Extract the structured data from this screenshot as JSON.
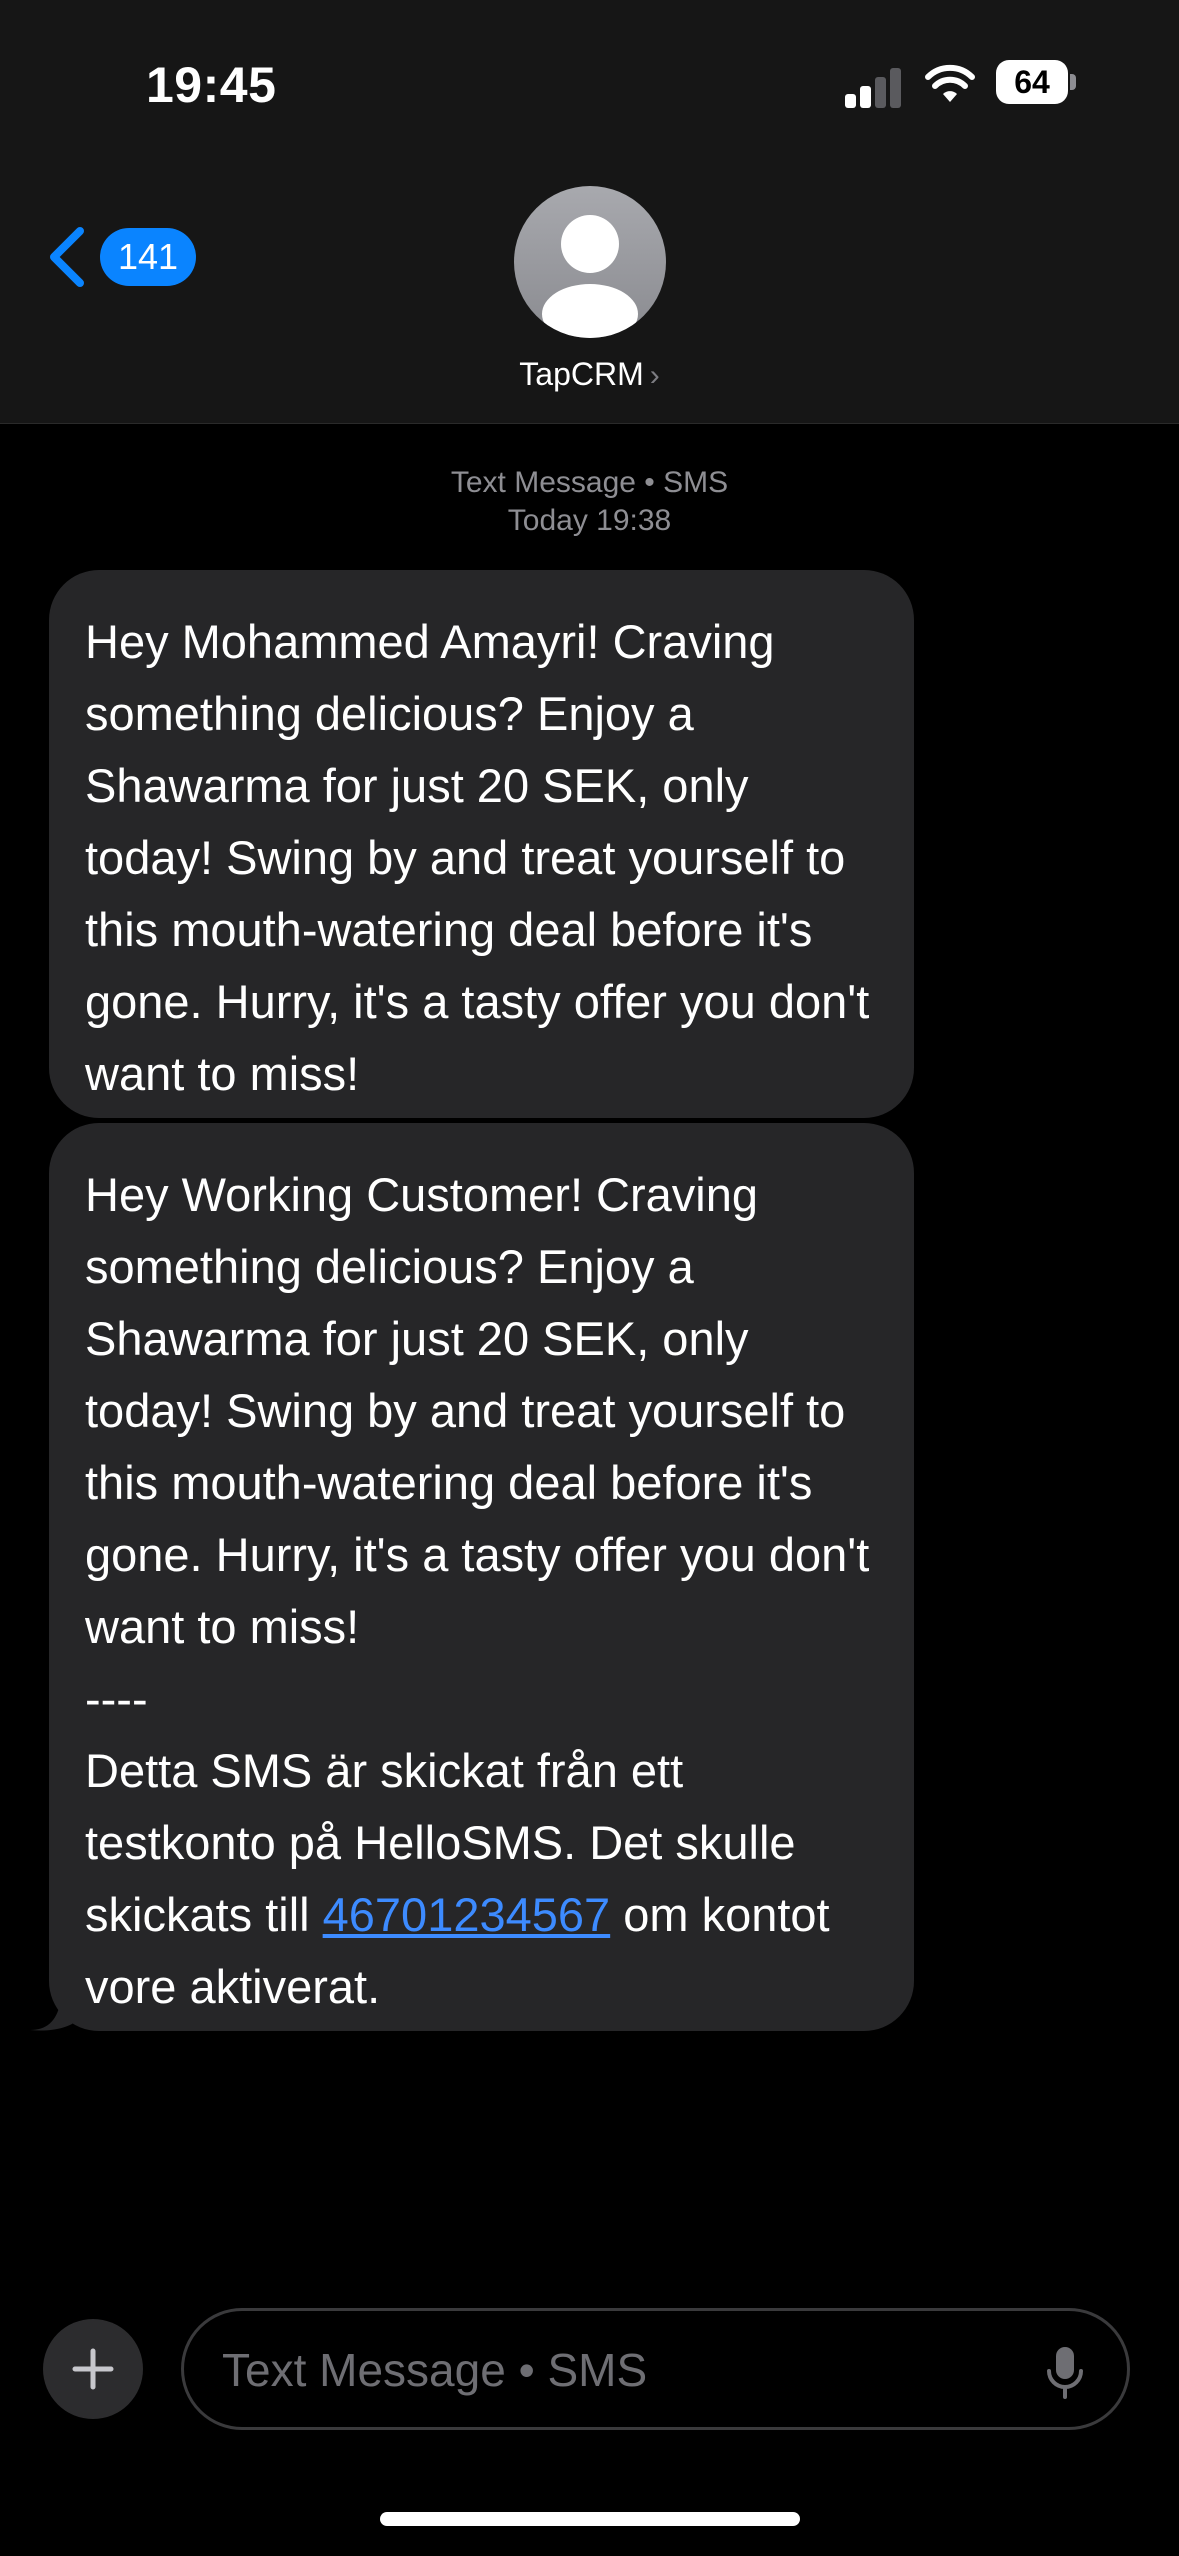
{
  "status_bar": {
    "time": "19:45",
    "battery": "64",
    "icons": [
      "signal-icon",
      "wifi-icon",
      "battery-icon"
    ]
  },
  "nav": {
    "back_count": "141",
    "back_icon": "chevron-left-icon",
    "contact_name": "TapCRM",
    "contact_chevron": "›",
    "avatar_icon": "person-icon"
  },
  "conversation": {
    "meta_line1": "Text Message • SMS",
    "meta_line2": "Today 19:38",
    "messages": [
      {
        "text": "Hey Mohammed Amayri! Craving something delicious? Enjoy a Shawarma for just 20 SEK, only today! Swing by and treat yourself to this mouth-watering deal before it's gone. Hurry, it's a tasty offer you don't want to miss!"
      },
      {
        "text_main": "Hey Working Customer! Craving something delicious? Enjoy a Shawarma for just 20 SEK, only today! Swing by and treat yourself to this mouth-watering deal before it's gone. Hurry, it's a tasty offer you don't want to miss!",
        "separator": "----",
        "footer_before": "Detta SMS är skickat från ett testkonto på HelloSMS. Det skulle skickats till ",
        "phone_link": "46701234567",
        "footer_after": " om kontot vore aktiverat."
      }
    ]
  },
  "compose": {
    "placeholder": "Text Message • SMS",
    "plus_icon": "plus-icon",
    "mic_icon": "microphone-icon"
  },
  "colors": {
    "accent": "#0a84ff",
    "bubble": "#262628",
    "header": "#161616",
    "background": "#000000",
    "link": "#3d8bff"
  }
}
